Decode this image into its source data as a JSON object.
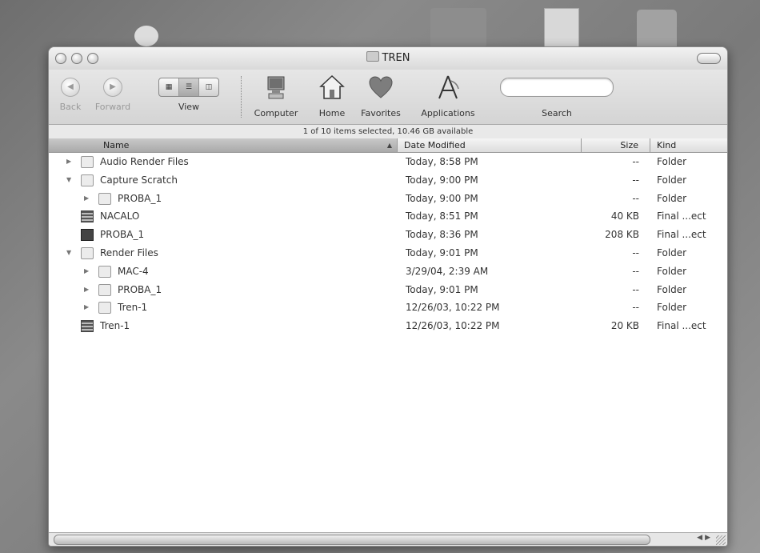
{
  "window": {
    "title": "TREN"
  },
  "toolbar": {
    "back_label": "Back",
    "forward_label": "Forward",
    "view_label": "View",
    "computer_label": "Computer",
    "home_label": "Home",
    "favorites_label": "Favorites",
    "applications_label": "Applications",
    "search_label": "Search"
  },
  "status": {
    "text": "1 of 10 items selected, 10.46 GB available"
  },
  "columns": {
    "name": "Name",
    "date": "Date Modified",
    "size": "Size",
    "kind": "Kind"
  },
  "rows": [
    {
      "name": "Audio Render Files",
      "date": "Today, 8:58 PM",
      "size": "--",
      "kind": "Folder",
      "indent": 0,
      "disclosure": "collapsed",
      "icon": "folder-icon"
    },
    {
      "name": "Capture Scratch",
      "date": "Today, 9:00 PM",
      "size": "--",
      "kind": "Folder",
      "indent": 0,
      "disclosure": "expanded",
      "icon": "folder-icon"
    },
    {
      "name": "PROBA_1",
      "date": "Today, 9:00 PM",
      "size": "--",
      "kind": "Folder",
      "indent": 1,
      "disclosure": "collapsed",
      "icon": "folder-icon"
    },
    {
      "name": "NACALO",
      "date": "Today, 8:51 PM",
      "size": "40 KB",
      "kind": "Final ...ect",
      "indent": 0,
      "disclosure": "none",
      "icon": "project-file-icon"
    },
    {
      "name": "PROBA_1",
      "date": "Today, 8:36 PM",
      "size": "208 KB",
      "kind": "Final ...ect",
      "indent": 0,
      "disclosure": "none",
      "icon": "document-icon"
    },
    {
      "name": "Render Files",
      "date": "Today, 9:01 PM",
      "size": "--",
      "kind": "Folder",
      "indent": 0,
      "disclosure": "expanded",
      "icon": "folder-icon"
    },
    {
      "name": "MAC-4",
      "date": "3/29/04, 2:39 AM",
      "size": "--",
      "kind": "Folder",
      "indent": 1,
      "disclosure": "collapsed",
      "icon": "folder-icon"
    },
    {
      "name": "PROBA_1",
      "date": "Today, 9:01 PM",
      "size": "--",
      "kind": "Folder",
      "indent": 1,
      "disclosure": "collapsed",
      "icon": "folder-icon"
    },
    {
      "name": "Tren-1",
      "date": "12/26/03, 10:22 PM",
      "size": "--",
      "kind": "Folder",
      "indent": 1,
      "disclosure": "collapsed",
      "icon": "folder-icon"
    },
    {
      "name": "Tren-1",
      "date": "12/26/03, 10:22 PM",
      "size": "20 KB",
      "kind": "Final ...ect",
      "indent": 0,
      "disclosure": "none",
      "icon": "project-file-icon"
    }
  ]
}
